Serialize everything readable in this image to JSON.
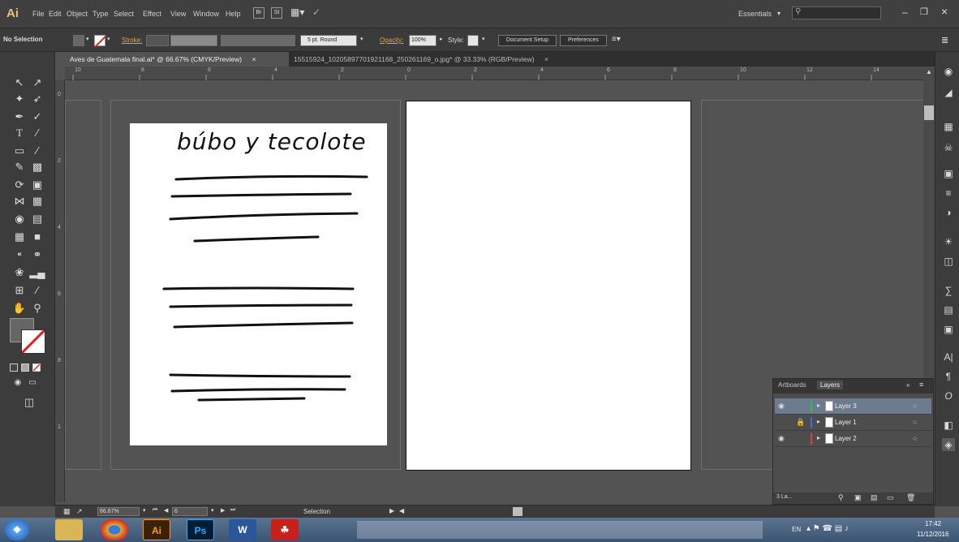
{
  "app": {
    "logo": "Ai",
    "menu": [
      "File",
      "Edit",
      "Object",
      "Type",
      "Select",
      "Effect",
      "View",
      "Window",
      "Help"
    ],
    "workspace": "Essentials",
    "search_placeholder": "",
    "bridge_icon": "Br",
    "stock_icon": "St"
  },
  "controlbar": {
    "selection_label": "No Selection",
    "stroke_label": "Stroke:",
    "brush_label": "5 pt. Round",
    "opacity_label": "Opacity:",
    "opacity_value": "100%",
    "style_label": "Style:",
    "document_setup": "Document Setup",
    "preferences": "Preferences"
  },
  "tabs": [
    {
      "label": "Aves de Guatemala final.ai* @ 66.67% (CMYK/Preview)",
      "close": "×"
    },
    {
      "label": "15515924_10205897701921168_250261169_o.jpg* @ 33.33% (RGB/Preview)",
      "close": "×"
    }
  ],
  "ruler": {
    "h_ticks": [
      "10",
      "8",
      "6",
      "4",
      "2",
      "0",
      "2",
      "4",
      "6",
      "8",
      "10",
      "12",
      "14"
    ],
    "v_ticks": [
      "0",
      "2",
      "4",
      "6",
      "8",
      "1"
    ]
  },
  "artboard": {
    "title_text": "búbo y tecolote"
  },
  "status": {
    "zoom": "66.67%",
    "page": "6",
    "tool": "Selection"
  },
  "layers_panel": {
    "tabs": [
      "Artboards",
      "Layers"
    ],
    "active_tab": "Layers",
    "layers": [
      {
        "name": "Layer 3",
        "color": "#2fbf2f",
        "visible": true,
        "locked": false,
        "selected": true
      },
      {
        "name": "Layer 1",
        "color": "#3b6ee8",
        "visible": false,
        "locked": true,
        "selected": false
      },
      {
        "name": "Layer 2",
        "color": "#e23b3b",
        "visible": true,
        "locked": false,
        "selected": false
      }
    ],
    "count_label": "3 La..."
  },
  "taskbar": {
    "apps": [
      "windows-start",
      "file-explorer",
      "chrome",
      "Ai",
      "Ps",
      "W",
      "acrobat"
    ],
    "lang": "EN",
    "time": "17:42",
    "date": "11/12/2016"
  },
  "colors": {
    "accent_orange": "#e8a046",
    "selection_blue": "#6d7b8e"
  }
}
